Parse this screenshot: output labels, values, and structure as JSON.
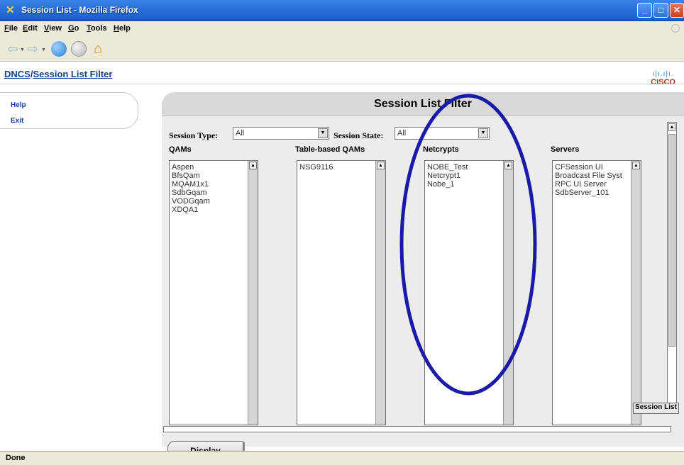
{
  "window": {
    "title": "Session List - Mozilla Firefox"
  },
  "menu": [
    "File",
    "Edit",
    "View",
    "Go",
    "Tools",
    "Help"
  ],
  "breadcrumb": {
    "root": "DNCS",
    "separator": "/",
    "current": "Session List Filter"
  },
  "logo": {
    "text": "CISCO"
  },
  "left_menu": {
    "help": "Help",
    "exit": "Exit"
  },
  "panel": {
    "title": "Session List Filter"
  },
  "filters": {
    "session_type_label": "Session Type:",
    "session_type_value": "All",
    "session_state_label": "Session State:",
    "session_state_value": "All"
  },
  "columns": {
    "qams": {
      "header": "QAMs",
      "items": [
        "Aspen",
        "BfsQam",
        "MQAM1x1",
        "SdbGqam",
        "VODGqam",
        "XDQA1"
      ]
    },
    "table_qams": {
      "header": "Table-based QAMs",
      "items": [
        "NSG9116"
      ]
    },
    "netcrypts": {
      "header": "Netcrypts",
      "items": [
        "NOBE_Test",
        "Netcrypt1",
        "Nobe_1"
      ]
    },
    "servers": {
      "header": "Servers",
      "items": [
        "CFSession UI",
        "Broadcast File Syst",
        "RPC UI Server",
        "SdbServer_101"
      ]
    }
  },
  "tooltip": "Session List",
  "display_button": "Display",
  "status": "Done",
  "colors": {
    "titlebar": "#2a6fd8",
    "annotation": "#1a1aa8",
    "panel": "#d9d9d9"
  }
}
